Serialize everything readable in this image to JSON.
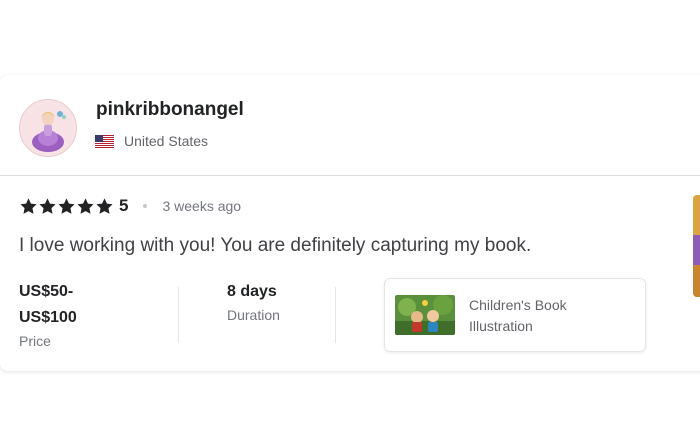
{
  "reviewer": {
    "username": "pinkribbonangel",
    "country": "United States",
    "avatar_icon": "doll-avatar-icon",
    "flag_icon": "us-flag-icon"
  },
  "review": {
    "rating": 5,
    "rating_label": "5",
    "time_ago": "3 weeks ago",
    "text": "I love working with you! You are definitely capturing my book.",
    "star_color": "#222325"
  },
  "details": {
    "price_line1": "US$50-",
    "price_line2": "US$100",
    "price_label": "Price",
    "duration_value": "8 days",
    "duration_label": "Duration"
  },
  "gig": {
    "title": "Children's Book Illustration",
    "thumb_icon": "illustration-thumbnail"
  }
}
